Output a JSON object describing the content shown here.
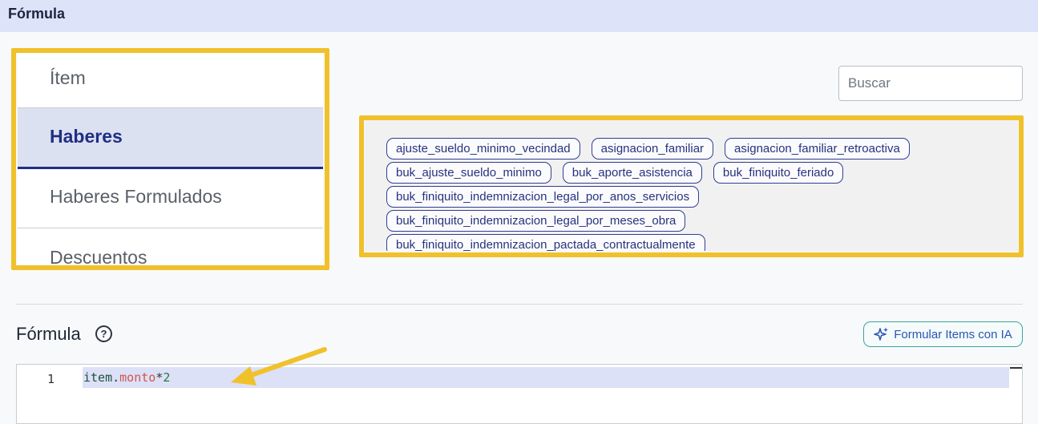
{
  "header": {
    "title": "Fórmula"
  },
  "categories": [
    {
      "label": "Ítem",
      "active": false
    },
    {
      "label": "Haberes",
      "active": true
    },
    {
      "label": "Haberes Formulados",
      "active": false
    },
    {
      "label": "Descuentos",
      "active": false
    }
  ],
  "search": {
    "placeholder": "Buscar",
    "value": ""
  },
  "tags": [
    "ajuste_sueldo_minimo_vecindad",
    "asignacion_familiar",
    "asignacion_familiar_retroactiva",
    "buk_ajuste_sueldo_minimo",
    "buk_aporte_asistencia",
    "buk_finiquito_feriado",
    "buk_finiquito_indemnizacion_legal_por_anos_servicios",
    "buk_finiquito_indemnizacion_legal_por_meses_obra",
    "buk_finiquito_indemnizacion_pactada_contractualmente"
  ],
  "formula": {
    "title": "Fórmula",
    "ai_button_label": "Formular Items con IA",
    "line_number": "1",
    "code": {
      "object": "item",
      "dot": ".",
      "property": "monto",
      "operator": "*",
      "number": "2"
    }
  },
  "icons": {
    "help": "question-circle-icon",
    "ai": "sparkle-icon"
  },
  "colors": {
    "accent": "#1f2f84",
    "highlight": "#f0c12b",
    "ai_border": "#3ea39a"
  }
}
